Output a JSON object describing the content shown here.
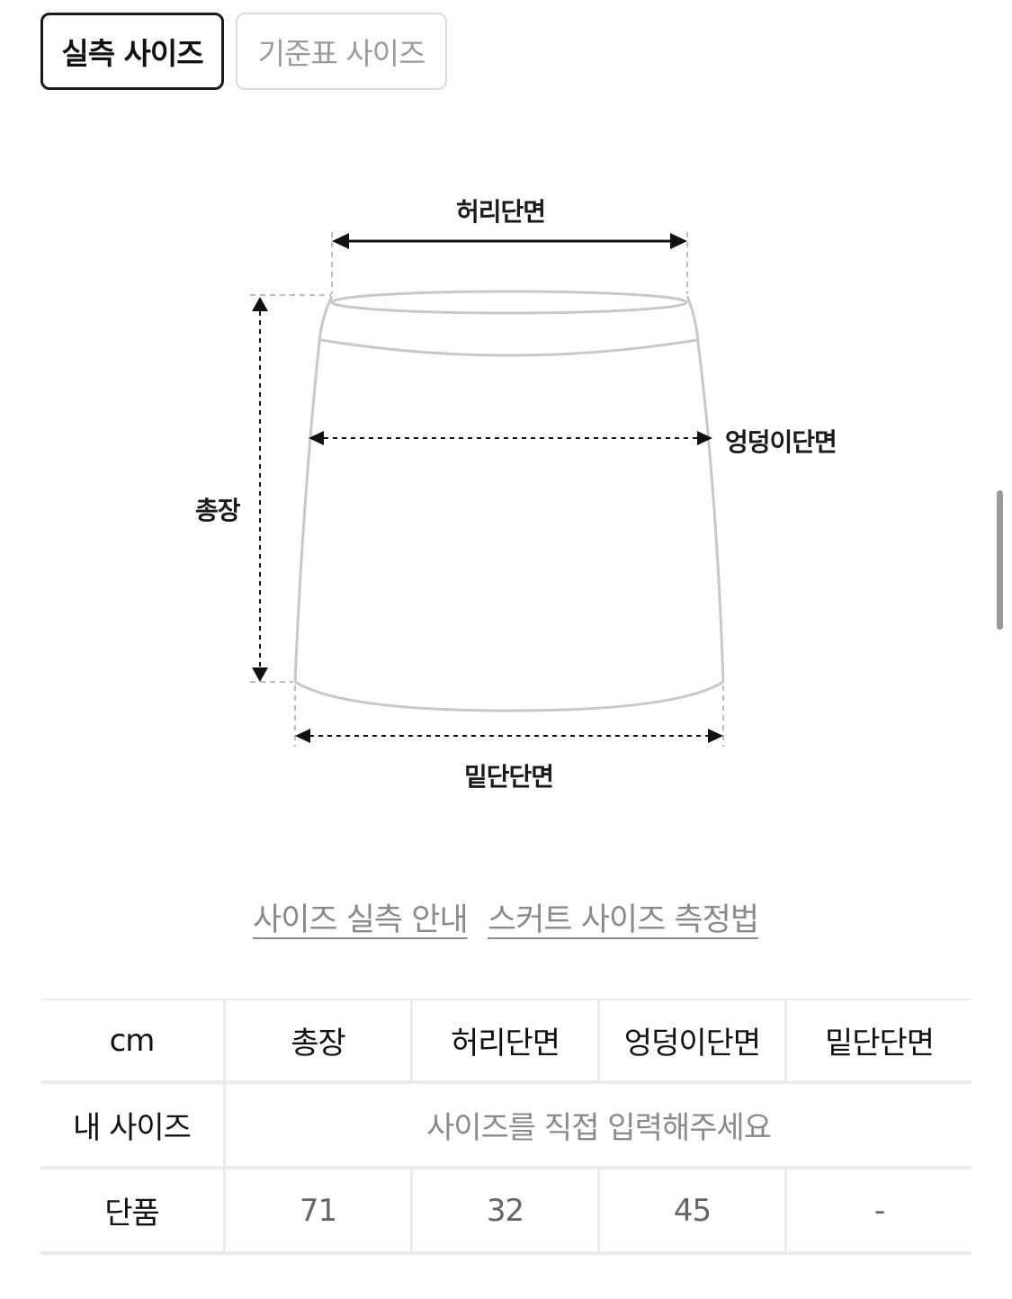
{
  "tabs": [
    {
      "label": "실측 사이즈",
      "active": true
    },
    {
      "label": "기준표 사이즈",
      "active": false
    }
  ],
  "diagram": {
    "waist_label": "허리단면",
    "hip_label": "엉덩이단면",
    "length_label": "총장",
    "hem_label": "밑단단면"
  },
  "links": {
    "measure_guide": "사이즈 실측 안내",
    "skirt_method": "스커트 사이즈 측정법"
  },
  "table": {
    "headers": [
      "cm",
      "총장",
      "허리단면",
      "엉덩이단면",
      "밑단단면"
    ],
    "my_size": {
      "label": "내 사이즈",
      "placeholder": "사이즈를 직접 입력해주세요"
    },
    "single": {
      "label": "단품",
      "values": [
        "71",
        "32",
        "45",
        "-"
      ]
    }
  },
  "colors": {
    "active_border": "#1a1a1a",
    "inactive_text": "#9b9b9b",
    "outline": "#c8c8c8"
  }
}
